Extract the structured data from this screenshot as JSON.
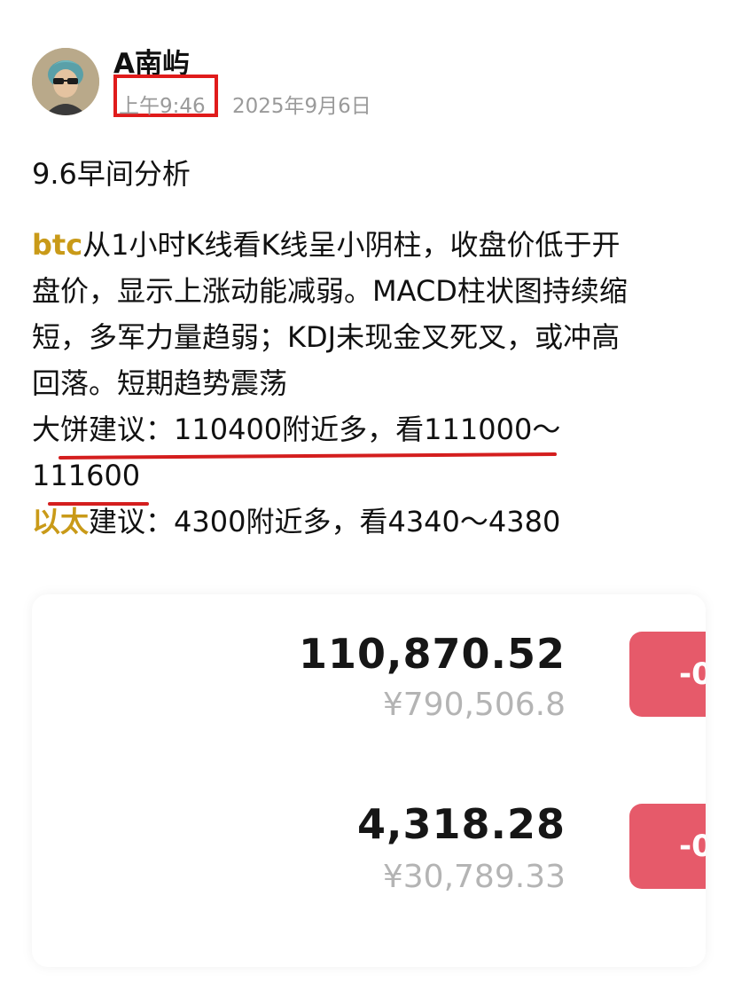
{
  "author": {
    "name": "A南屿",
    "time": "上午9:46",
    "date": "2025年9月6日",
    "avatar_icon": "person-with-sunglasses-avatar"
  },
  "post": {
    "title": "9.6早间分析",
    "btc_tag": "btc",
    "analysis_lines": [
      "从1小时K线看K线呈小阴柱，收盘价低于开",
      "盘价，显示上涨动能减弱。MACD柱状图持续缩",
      "短，多军力量趋弱；KDJ未现金叉死叉，或冲高",
      "回落。短期趋势震荡"
    ],
    "btc_advice_line1": "大饼建议：110400附近多，看111000～",
    "btc_advice_line2": "111600",
    "eth_tag": "以太",
    "eth_advice": "建议：4300附近多，看4340～4380"
  },
  "prices": [
    {
      "price": "110,870.52",
      "cny": "¥790,506.8",
      "change": "-0"
    },
    {
      "price": "4,318.28",
      "cny": "¥30,789.33",
      "change": "-0"
    }
  ],
  "colors": {
    "accent_gold": "#c99a18",
    "highlight_red": "#e01b1b",
    "down_red": "#e65a6a",
    "muted_gray": "#9a9a9a"
  }
}
